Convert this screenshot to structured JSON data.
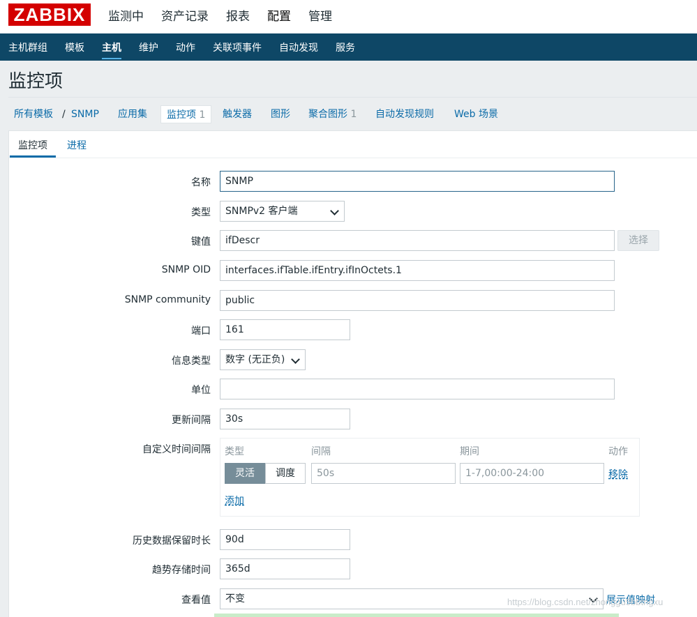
{
  "brand": {
    "logo_text": "ZABBIX",
    "logo_color": "#d40000"
  },
  "top_nav": [
    "监测中",
    "资产记录",
    "报表",
    "配置",
    "管理"
  ],
  "sub_nav": [
    "主机群组",
    "模板",
    "主机",
    "维护",
    "动作",
    "关联项事件",
    "自动发现",
    "服务"
  ],
  "page_title": "监控项",
  "breadcrumb": {
    "all_templates": "所有模板",
    "separator": "/",
    "template": "SNMP",
    "applications": "应用集",
    "items": "监控项",
    "items_count": "1",
    "triggers": "触发器",
    "graphs": "图形",
    "screens": "聚合图形",
    "screens_count": "1",
    "discovery": "自动发现规则",
    "web": "Web 场景"
  },
  "form_tabs": {
    "item": "监控项",
    "process": "进程"
  },
  "form": {
    "name_label": "名称",
    "name_value": "SNMP",
    "type_label": "类型",
    "type_value": "SNMPv2 客户端",
    "key_label": "键值",
    "key_value": "ifDescr",
    "select_button": "选择",
    "oid_label": "SNMP OID",
    "oid_value": "interfaces.ifTable.ifEntry.ifInOctets.1",
    "community_label": "SNMP community",
    "community_value": "public",
    "port_label": "端口",
    "port_value": "161",
    "info_type_label": "信息类型",
    "info_type_value": "数字 (无正负)",
    "units_label": "单位",
    "units_value": "",
    "interval_label": "更新间隔",
    "interval_value": "30s",
    "custom_label": "自定义时间间隔",
    "custom": {
      "col_type": "类型",
      "col_interval": "间隔",
      "col_period": "期间",
      "col_action": "动作",
      "flexible": "灵活",
      "scheduling": "调度",
      "interval_placeholder": "50s",
      "period_placeholder": "1-7,00:00-24:00",
      "remove": "移除",
      "add": "添加"
    },
    "history_label": "历史数据保留时长",
    "history_value": "90d",
    "trends_label": "趋势存储时间",
    "trends_value": "365d",
    "valuemap_label": "查看值",
    "valuemap_value": "不变",
    "valuemap_link": "展示值映射"
  },
  "watermark": "https://blog.csdn.net/zhonggu5bbtngxu"
}
